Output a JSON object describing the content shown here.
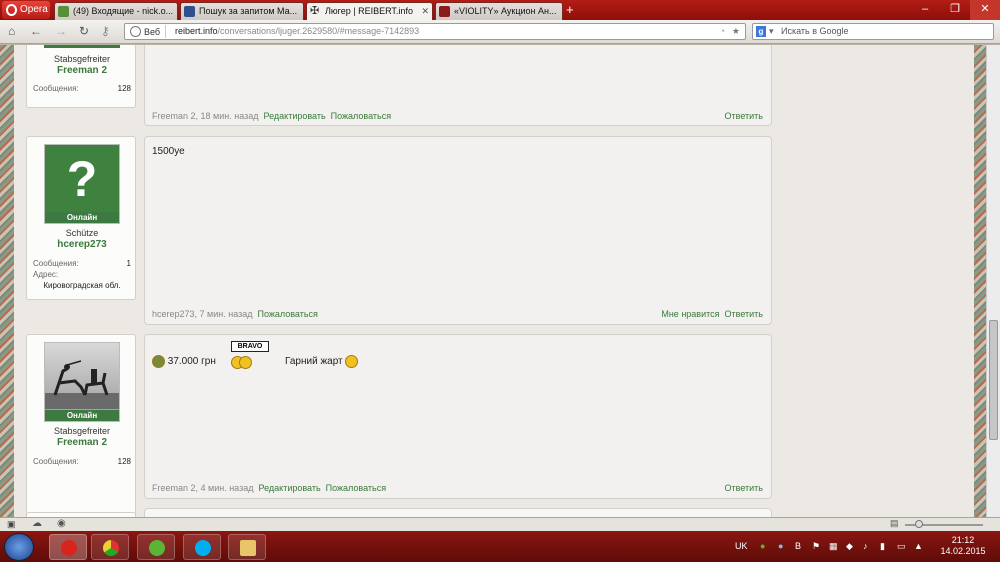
{
  "browser": {
    "menu_label": "Opera",
    "tabs": [
      {
        "title": "(49) Входящие - nick.o...",
        "icon_color": "#5a8f3a"
      },
      {
        "title": "Пошук за запитом Ма...",
        "icon_color": "#2f4f8f"
      },
      {
        "title": "Люгер | REIBERT.info",
        "icon_color": "#333333"
      },
      {
        "title": "«VIOLITY» Аукцион Ан...",
        "icon_color": "#8b1a1a"
      }
    ],
    "new_tab": "+",
    "address": {
      "site_label": "Веб",
      "host": "reibert.info",
      "path": "/conversations/ljuger.2629580/#message-7142893"
    },
    "search_placeholder": "Искать в Google"
  },
  "posts": [
    {
      "rank": "Stabsgefreiter",
      "username": "Freeman 2",
      "messages_label": "Сообщения:",
      "messages_count": "128",
      "footer_author": "Freeman 2, 18 мин. назад",
      "edit": "Редактировать",
      "report": "Пожаловаться",
      "reply": "Ответить"
    },
    {
      "online": "Онлайн",
      "rank": "Schütze",
      "username": "hcerep273",
      "messages_label": "Сообщения:",
      "messages_count": "1",
      "address_label": "Адрес:",
      "address_value": "Кировоградская обл.",
      "text": "1500уе",
      "footer_author": "hcerep273, 7 мин. назад",
      "report": "Пожаловаться",
      "like": "Мне нравится",
      "reply": "Ответить"
    },
    {
      "online": "Онлайн",
      "rank": "Stabsgefreiter",
      "username": "Freeman 2",
      "messages_label": "Сообщения:",
      "messages_count": "128",
      "text_price": "37.000 грн",
      "bravo_label": "BRAVO",
      "text_joke": "Гарний жарт",
      "footer_author": "Freeman 2, 4 мин. назад",
      "edit": "Редактировать",
      "report": "Пожаловаться",
      "reply": "Ответить"
    }
  ],
  "taskbar": {
    "language": "UK",
    "time": "21:12",
    "date": "14.02.2015"
  },
  "colors": {
    "accent_green": "#3a7a3c",
    "chrome_red": "#9b1811"
  }
}
